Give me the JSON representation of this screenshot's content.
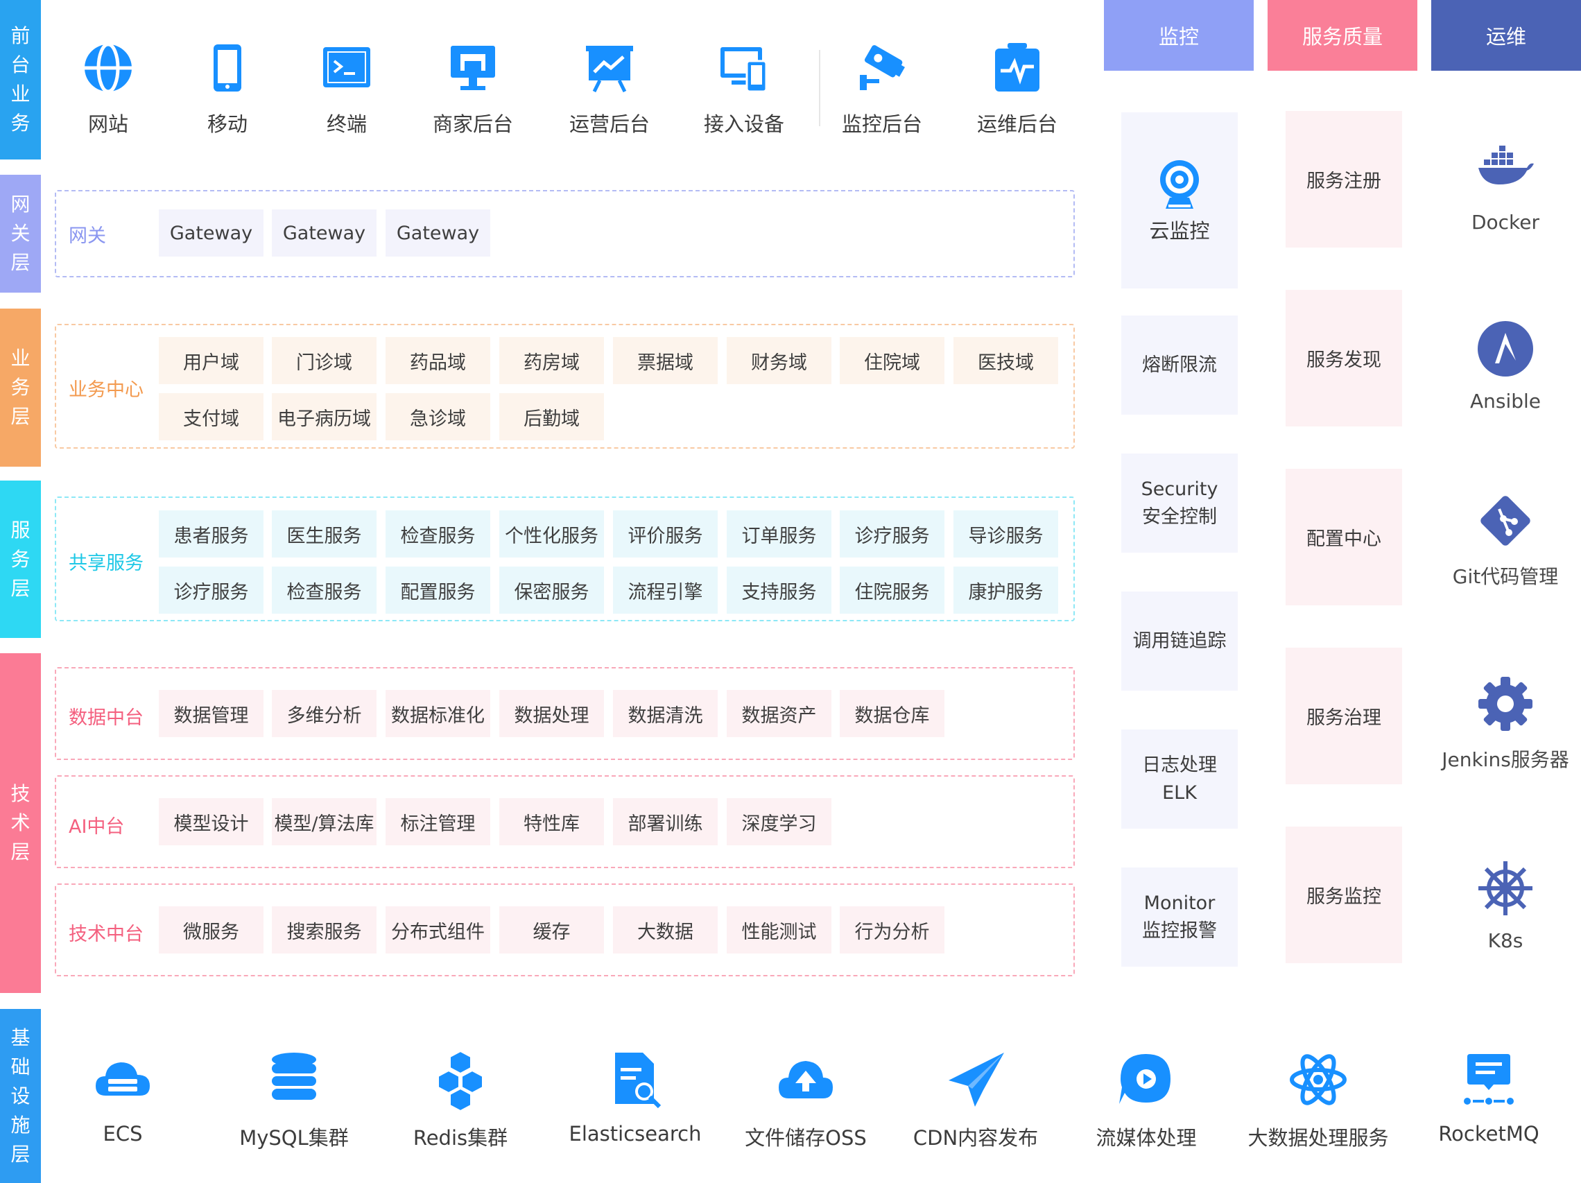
{
  "layers": {
    "front": "前台业务",
    "gateway": "网关层",
    "business": "业务层",
    "service": "服务层",
    "tech": "技术层",
    "infra": "基础设施层"
  },
  "front_items": [
    {
      "label": "网站",
      "icon": "globe-icon"
    },
    {
      "label": "移动",
      "icon": "mobile-icon"
    },
    {
      "label": "终端",
      "icon": "terminal-icon"
    },
    {
      "label": "商家后台",
      "icon": "store-icon"
    },
    {
      "label": "运营后台",
      "icon": "chart-board-icon"
    },
    {
      "label": "接入设备",
      "icon": "devices-icon"
    },
    {
      "label": "监控后台",
      "icon": "camera-icon"
    },
    {
      "label": "运维后台",
      "icon": "pulse-icon"
    }
  ],
  "gateway": {
    "label": "网关",
    "items": [
      "Gateway",
      "Gateway",
      "Gateway"
    ]
  },
  "business": {
    "label": "业务中心",
    "row1": [
      "用户域",
      "门诊域",
      "药品域",
      "药房域",
      "票据域",
      "财务域",
      "住院域",
      "医技域"
    ],
    "row2": [
      "支付域",
      "电子病历域",
      "急诊域",
      "后勤域"
    ]
  },
  "service": {
    "label": "共享服务",
    "row1": [
      "患者服务",
      "医生服务",
      "检查服务",
      "个性化服务",
      "评价服务",
      "订单服务",
      "诊疗服务",
      "导诊服务"
    ],
    "row2": [
      "诊疗服务",
      "检查服务",
      "配置服务",
      "保密服务",
      "流程引擎",
      "支持服务",
      "住院服务",
      "康护服务"
    ]
  },
  "data_platform": {
    "label": "数据中台",
    "items": [
      "数据管理",
      "多维分析",
      "数据标准化",
      "数据处理",
      "数据清洗",
      "数据资产",
      "数据仓库"
    ]
  },
  "ai_platform": {
    "label": "AI中台",
    "items": [
      "模型设计",
      "模型/算法库",
      "标注管理",
      "特性库",
      "部署训练",
      "深度学习"
    ]
  },
  "tech_platform": {
    "label": "技术中台",
    "items": [
      "微服务",
      "搜索服务",
      "分布式组件",
      "缓存",
      "大数据",
      "性能测试",
      "行为分析"
    ]
  },
  "columns": {
    "monitor": "监控",
    "quality": "服务质量",
    "ops": "运维"
  },
  "monitor_items": [
    {
      "line1": "云监控",
      "line2": "",
      "icon": "webcam-icon"
    },
    {
      "line1": "熔断限流",
      "line2": ""
    },
    {
      "line1": "Security",
      "line2": "安全控制"
    },
    {
      "line1": "调用链追踪",
      "line2": ""
    },
    {
      "line1": "日志处理",
      "line2": "ELK"
    },
    {
      "line1": "Monitor",
      "line2": "监控报警"
    }
  ],
  "quality_items": [
    "服务注册",
    "服务发现",
    "配置中心",
    "服务治理",
    "服务监控"
  ],
  "ops_items": [
    {
      "label": "Docker",
      "icon": "docker-icon"
    },
    {
      "label": "Ansible",
      "icon": "ansible-icon"
    },
    {
      "label": "Git代码管理",
      "icon": "git-icon"
    },
    {
      "label": "Jenkins服务器",
      "icon": "gear-icon"
    },
    {
      "label": "K8s",
      "icon": "helm-icon"
    }
  ],
  "infra_items": [
    {
      "label": "ECS",
      "icon": "cloud-server-icon"
    },
    {
      "label": "MySQL集群",
      "icon": "database-icon"
    },
    {
      "label": "Redis集群",
      "icon": "cubes-icon"
    },
    {
      "label": "Elasticsearch",
      "icon": "doc-search-icon"
    },
    {
      "label": "文件储存OSS",
      "icon": "cloud-upload-icon"
    },
    {
      "label": "CDN内容发布",
      "icon": "paper-plane-icon"
    },
    {
      "label": "流媒体处理",
      "icon": "play-chat-icon"
    },
    {
      "label": "大数据处理服务",
      "icon": "atom-icon"
    },
    {
      "label": "RocketMQ",
      "icon": "message-queue-icon"
    }
  ],
  "colors": {
    "blue": "#1890ff",
    "front_bar": "#29a3f0",
    "gateway_bar": "#9ea8f5",
    "business_bar": "#f6a866",
    "service_bar": "#2ed8f3",
    "tech_bar": "#fb7b95",
    "infra_bar": "#2e9cf2",
    "monitor_head": "#8fa0f6",
    "quality_head": "#fa7f98",
    "ops_head": "#4b63b5"
  }
}
